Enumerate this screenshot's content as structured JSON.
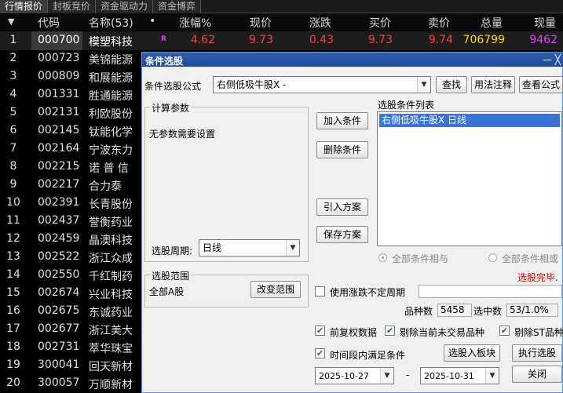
{
  "tabs": [
    "行情报价",
    "封板竞价",
    "资金驱动力",
    "资金博弈"
  ],
  "header": {
    "sort_icon": "▼",
    "code": "代码",
    "name": "名称(53)",
    "dot": "•",
    "change_pct": "涨幅%",
    "price": "现价",
    "change": "涨跌",
    "bid": "买价",
    "ask": "卖价",
    "volume": "总量",
    "cur_volume": "现量"
  },
  "first_row": {
    "index": "1",
    "code": "000700",
    "name": "模塑科技",
    "tag": "R",
    "change_pct": "4.62",
    "price": "9.73",
    "change": "0.43",
    "bid": "9.73",
    "ask": "9.74",
    "volume": "706799",
    "cur_volume": "9462"
  },
  "rows": [
    {
      "index": "2",
      "code": "000723",
      "name": "美锦能源"
    },
    {
      "index": "3",
      "code": "000809",
      "name": "和展能源"
    },
    {
      "index": "4",
      "code": "001331",
      "name": "胜通能源"
    },
    {
      "index": "5",
      "code": "002131",
      "name": "利欧股份"
    },
    {
      "index": "6",
      "code": "002145",
      "name": "钛能化学"
    },
    {
      "index": "7",
      "code": "002164",
      "name": "宁波东力"
    },
    {
      "index": "8",
      "code": "002215",
      "name": "诺 普 信"
    },
    {
      "index": "9",
      "code": "002217",
      "name": "合力泰"
    },
    {
      "index": "10",
      "code": "002391",
      "name": "长青股份"
    },
    {
      "index": "11",
      "code": "002437",
      "name": "誉衡药业"
    },
    {
      "index": "12",
      "code": "002459",
      "name": "晶澳科技"
    },
    {
      "index": "13",
      "code": "002522",
      "name": "浙江众成"
    },
    {
      "index": "14",
      "code": "002550",
      "name": "千红制药"
    },
    {
      "index": "15",
      "code": "002674",
      "name": "兴业科技"
    },
    {
      "index": "16",
      "code": "002675",
      "name": "东诚药业"
    },
    {
      "index": "17",
      "code": "002677",
      "name": "浙江美大"
    },
    {
      "index": "18",
      "code": "002731",
      "name": "萃华珠宝"
    },
    {
      "index": "19",
      "code": "300041",
      "name": "回天新材"
    },
    {
      "index": "20",
      "code": "300057",
      "name": "万顺新材"
    }
  ],
  "dialog": {
    "title": "条件选股",
    "title_buttons": "— ╳",
    "formula_label": "条件选股公式",
    "formula_value": "右侧低吸牛股X  -",
    "btn_find": "查找",
    "btn_usage": "用法注释",
    "btn_view": "查看公式",
    "params_group": "计算参数",
    "params_text": "无参数需要设置",
    "period_label": "选股周期:",
    "period_value": "日线",
    "btn_add": "加入条件",
    "btn_delete": "删除条件",
    "btn_import": "引入方案",
    "btn_save": "保存方案",
    "list_label": "选股条件列表",
    "list_items": [
      "右侧低吸牛股X  日线"
    ],
    "radio_and": "全部条件相与",
    "radio_or": "全部条件相或",
    "status": "选股完毕.",
    "scope_group": "选股范围",
    "scope_value": "全部A股",
    "btn_change_scope": "改变范围",
    "use_variable_period": "使用涨跌不定周期",
    "count_label": "品种数",
    "count_value": "5458",
    "selected_label": "选中数",
    "selected_value": "53/1.0%",
    "chk_adjusted": "前复权数据",
    "chk_exclude_untraded": "剔除当前未交易品种",
    "chk_exclude_st": "剔除ST品种",
    "chk_time_range": "时间段内满足条件",
    "btn_to_board": "选股入板块",
    "btn_execute": "执行选股",
    "date_from": "2025-10-27",
    "date_sep": "-",
    "date_to": "2025-10-31",
    "btn_close": "关闭"
  },
  "colors": {
    "up": "#ff3b3b",
    "volume": "#ffd700",
    "cur_volume": "#e040fb",
    "accent": "#22479a"
  }
}
